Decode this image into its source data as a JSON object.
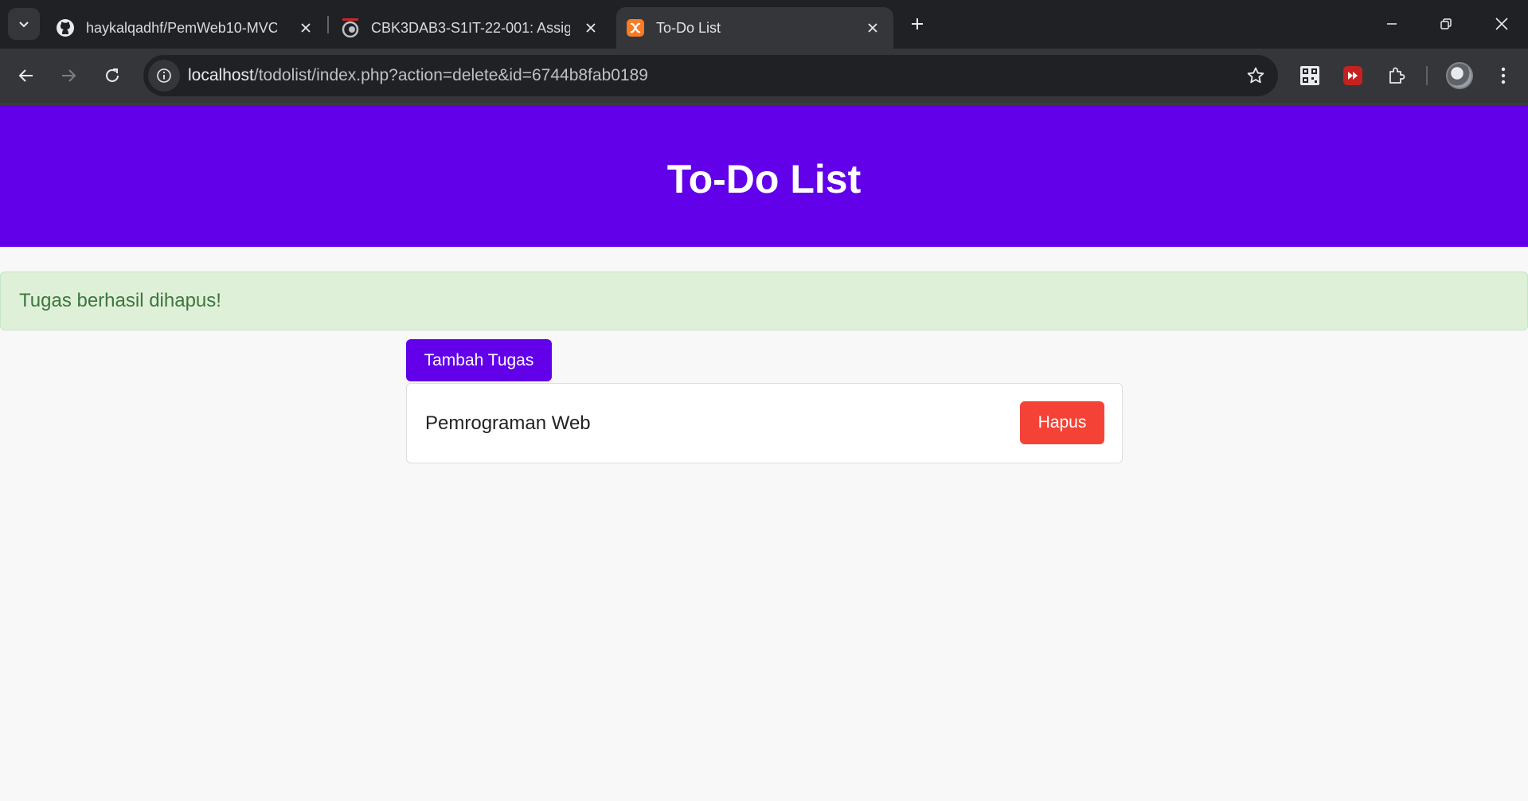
{
  "browser": {
    "tabs": [
      {
        "title": "haykalqadhf/PemWeb10-MVC",
        "favicon": "github-icon",
        "active": false
      },
      {
        "title": "CBK3DAB3-S1IT-22-001: Assign",
        "favicon": "lms-icon",
        "active": false
      },
      {
        "title": "To-Do List",
        "favicon": "xampp-icon",
        "active": true
      }
    ],
    "address": {
      "host": "localhost",
      "path": "/todolist/index.php?action=delete&id=6744b8fab0189"
    },
    "colors": {
      "tabstrip": "#202124",
      "toolbar": "#35363a"
    }
  },
  "page": {
    "title": "To-Do List",
    "alert": "Tugas berhasil dihapus!",
    "add_button": "Tambah Tugas",
    "tasks": [
      {
        "name": "Pemrograman Web",
        "delete_label": "Hapus"
      }
    ],
    "colors": {
      "primary": "#6200ea",
      "danger": "#f44336",
      "success_bg": "#dff0d8",
      "success_text": "#3c763d"
    }
  }
}
